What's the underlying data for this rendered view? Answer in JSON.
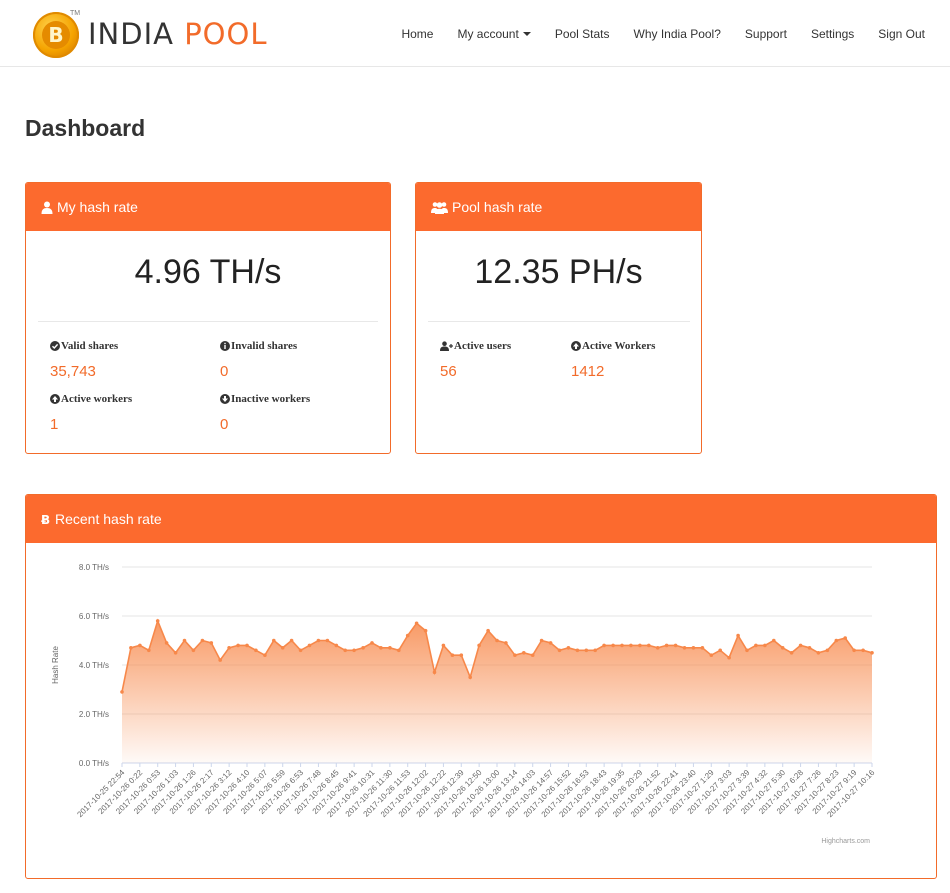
{
  "brand": {
    "name_part1": "INDIA",
    "name_part2": "POOL",
    "tm": "TM",
    "coin_symbol": "B"
  },
  "nav": {
    "home": "Home",
    "my_account": "My account",
    "pool_stats": "Pool Stats",
    "why": "Why India Pool?",
    "support": "Support",
    "settings": "Settings",
    "sign_out": "Sign Out"
  },
  "page_title": "Dashboard",
  "my_hash": {
    "title": "My hash rate",
    "value": "4.96 TH/s",
    "valid_shares_label": "Valid shares",
    "valid_shares": "35,743",
    "invalid_shares_label": "Invalid shares",
    "invalid_shares": "0",
    "active_workers_label": "Active workers",
    "active_workers": "1",
    "inactive_workers_label": "Inactive workers",
    "inactive_workers": "0"
  },
  "pool_hash": {
    "title": "Pool hash rate",
    "value": "12.35 PH/s",
    "active_users_label": "Active users",
    "active_users": "56",
    "active_workers_label": "Active Workers",
    "active_workers": "1412"
  },
  "recent": {
    "title": "Recent hash rate",
    "credits": "Highcharts.com"
  },
  "colors": {
    "accent": "#fc6a2e",
    "line": "#f7884a",
    "value_text": "#f26b2a"
  },
  "chart_data": {
    "type": "area",
    "ylabel": "Hash Rate",
    "xlabel": "",
    "ylim": [
      0,
      8
    ],
    "y_unit": "TH/s",
    "y_ticks": [
      "0.0 TH/s",
      "2.0 TH/s",
      "4.0 TH/s",
      "6.0 TH/s",
      "8.0 TH/s"
    ],
    "grid": true,
    "legend": "none",
    "x_labels_shown": [
      "2017-10-25 22:54",
      "2017-10-26 0:22",
      "2017-10-26 0:53",
      "2017-10-26 1:03",
      "2017-10-26 1:26",
      "2017-10-26 2:17",
      "2017-10-26 3:12",
      "2017-10-26 4:10",
      "2017-10-26 5:07",
      "2017-10-26 5:59",
      "2017-10-26 6:53",
      "2017-10-26 7:48",
      "2017-10-26 8:45",
      "2017-10-26 9:41",
      "2017-10-26 10:31",
      "2017-10-26 11:30",
      "2017-10-26 11:53",
      "2017-10-26 12:02",
      "2017-10-26 12:22",
      "2017-10-26 12:39",
      "2017-10-26 12:50",
      "2017-10-26 13:00",
      "2017-10-26 13:14",
      "2017-10-26 14:03",
      "2017-10-26 14:57",
      "2017-10-26 15:52",
      "2017-10-26 16:53",
      "2017-10-26 18:43",
      "2017-10-26 19:35",
      "2017-10-26 20:29",
      "2017-10-26 21:52",
      "2017-10-26 22:41",
      "2017-10-26 23:40",
      "2017-10-27 1:29",
      "2017-10-27 3:03",
      "2017-10-27 3:39",
      "2017-10-27 4:32",
      "2017-10-27 5:30",
      "2017-10-27 6:28",
      "2017-10-27 7:26",
      "2017-10-27 8:23",
      "2017-10-27 9:19",
      "2017-10-27 10:16"
    ],
    "values": [
      2.9,
      4.7,
      4.8,
      4.6,
      5.8,
      4.9,
      4.5,
      5.0,
      4.6,
      5.0,
      4.9,
      4.2,
      4.7,
      4.8,
      4.8,
      4.6,
      4.4,
      5.0,
      4.7,
      5.0,
      4.6,
      4.8,
      5.0,
      5.0,
      4.8,
      4.6,
      4.6,
      4.7,
      4.9,
      4.7,
      4.7,
      4.6,
      5.2,
      5.7,
      5.4,
      3.7,
      4.8,
      4.4,
      4.4,
      3.5,
      4.8,
      5.4,
      5.0,
      4.9,
      4.4,
      4.5,
      4.4,
      5.0,
      4.9,
      4.6,
      4.7,
      4.6,
      4.6,
      4.6,
      4.8,
      4.8,
      4.8,
      4.8,
      4.8,
      4.8,
      4.7,
      4.8,
      4.8,
      4.7,
      4.7,
      4.7,
      4.4,
      4.6,
      4.3,
      5.2,
      4.6,
      4.8,
      4.8,
      5.0,
      4.7,
      4.5,
      4.8,
      4.7,
      4.5,
      4.6,
      5.0,
      5.1,
      4.6,
      4.6,
      4.5
    ]
  }
}
